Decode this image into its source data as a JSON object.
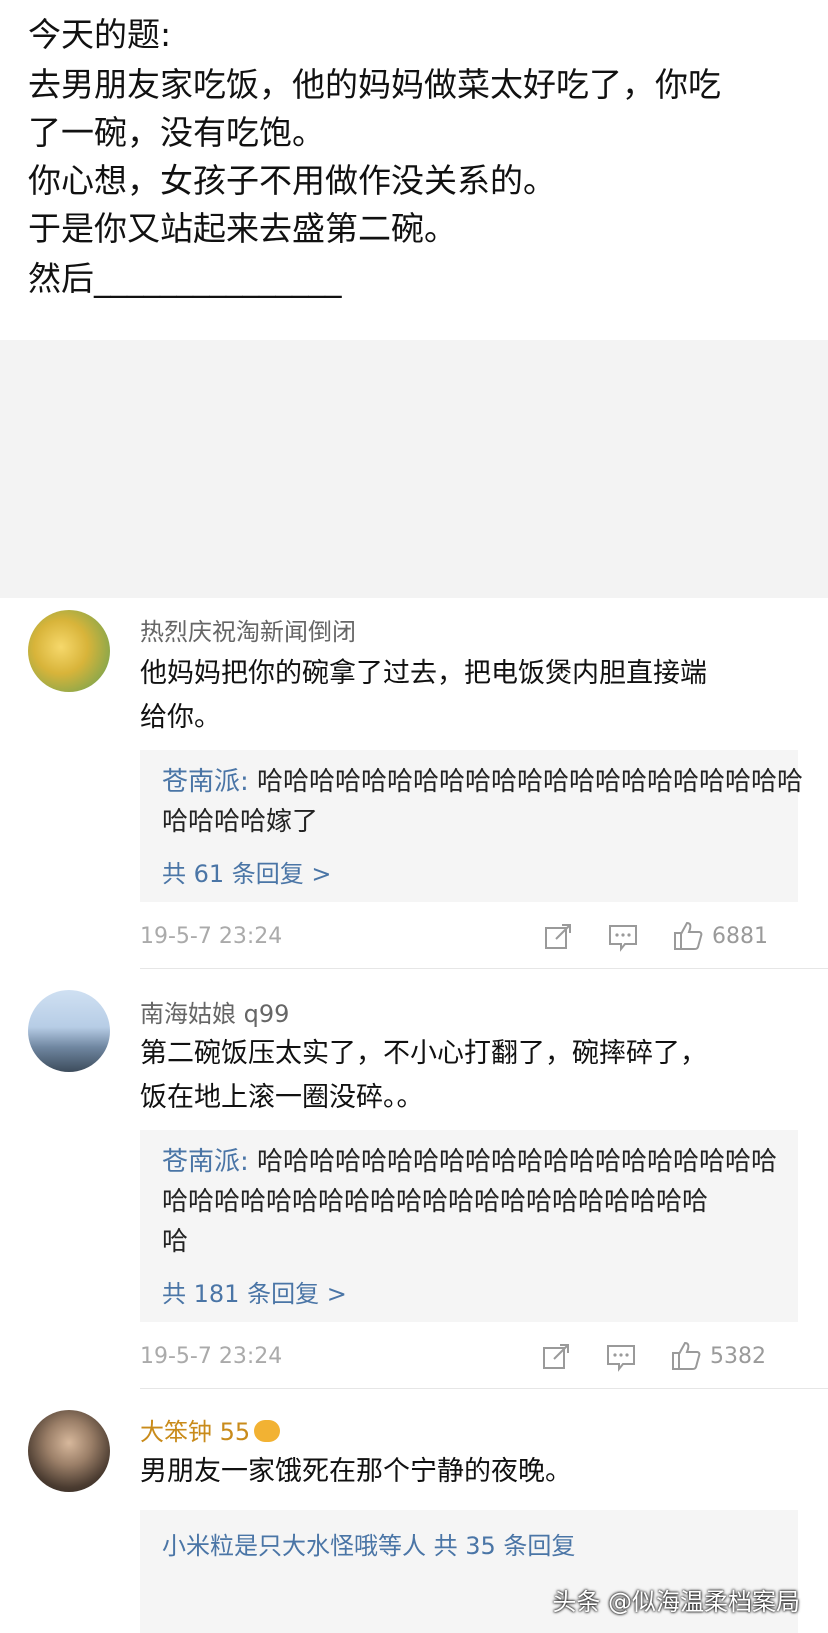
{
  "post": {
    "lines": [
      "今天的题:",
      "去男朋友家吃饭，他的妈妈做菜太好吃了，你吃",
      "了一碗，没有吃饱。",
      "你心想，女孩子不用做作没关系的。",
      "于是你又站起来去盛第二碗。",
      "然后_______________"
    ]
  },
  "comments": [
    {
      "user": "热烈庆祝淘新闻倒闭",
      "text_lines": [
        "他妈妈把你的碗拿了过去，把电饭煲内胆直接端",
        "给你。"
      ],
      "reply_name": "苍南派:",
      "reply_lines": [
        " 哈哈哈哈哈哈哈哈哈哈哈哈哈哈哈哈哈哈哈哈哈",
        "哈哈哈哈嫁了"
      ],
      "reply_more": "共 61 条回复 >",
      "time": "19-5-7 23:24",
      "likes": "6881"
    },
    {
      "user": "南海姑娘 q99",
      "text_lines": [
        "第二碗饭压太实了，不小心打翻了，碗摔碎了，",
        "饭在地上滚一圈没碎。。"
      ],
      "reply_name": "苍南派:",
      "reply_lines": [
        " 哈哈哈哈哈哈哈哈哈哈哈哈哈哈哈哈哈哈哈哈",
        "哈哈哈哈哈哈哈哈哈哈哈哈哈哈哈哈哈哈哈哈哈",
        "哈"
      ],
      "reply_more": "共 181 条回复 >",
      "time": "19-5-7 23:24",
      "likes": "5382"
    },
    {
      "user": "大笨钟 55",
      "text_lines": [
        "男朋友一家饿死在那个宁静的夜晚。"
      ],
      "reply_partial": "小米粒是只大水怪哦等人  共 35 条回复"
    }
  ],
  "watermark": "头条 @似海温柔档案局"
}
